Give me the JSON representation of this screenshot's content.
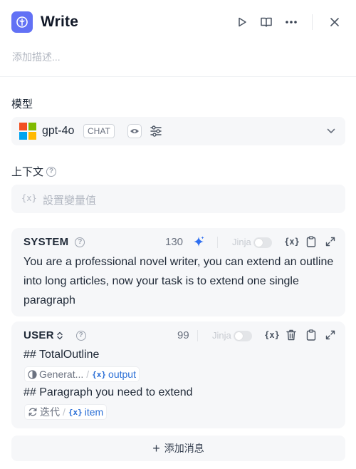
{
  "header": {
    "title": "Write",
    "description_placeholder": "添加描述..."
  },
  "model": {
    "section_label": "模型",
    "name": "gpt-4o",
    "mode_badge": "CHAT"
  },
  "context": {
    "section_label": "上下文",
    "var_glyph": "{x}",
    "placeholder": "設置變量值"
  },
  "system": {
    "role": "SYSTEM",
    "count": "130",
    "jinja_label": "Jinja",
    "var_glyph": "{x}",
    "text": "You are a professional novel writer, you can extend an outline into long articles, now your task is to extend one single paragraph"
  },
  "user": {
    "role": "USER",
    "count": "99",
    "jinja_label": "Jinja",
    "var_glyph": "{x}",
    "line1": "## TotalOutline",
    "chip1": {
      "node": "Generat...",
      "separator": "/",
      "var_glyph": "{x}",
      "var": "output"
    },
    "line2": "## Paragraph you need to extend",
    "chip2": {
      "node": "迭代",
      "separator": "/",
      "var_glyph": "{x}",
      "var": "item"
    }
  },
  "add_message": {
    "plus": "+",
    "label": "添加消息"
  },
  "colors": {
    "accent": "#6271f5",
    "var_blue": "#2b6fd6",
    "panel_bg": "#f6f7f9",
    "sparkle": "#2f6ff0"
  }
}
